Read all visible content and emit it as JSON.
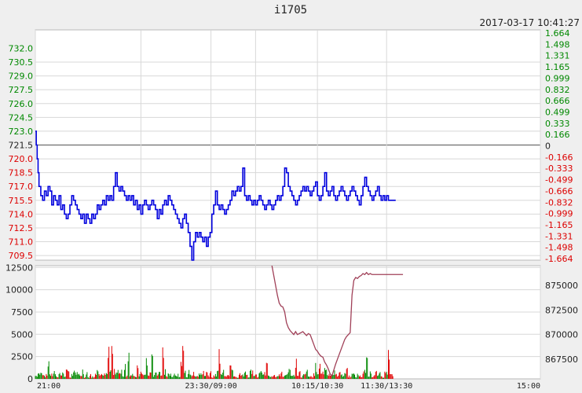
{
  "title": "i1705",
  "timestamp": "2017-03-17 10:41:27",
  "colors": {
    "up": "#e00000",
    "down": "#008800",
    "price_line": "#0000dd",
    "oi_line": "#a04058",
    "grid": "#d8d8d8",
    "axis_left_price_up": "#008800",
    "axis_left_price_down": "#dd0000"
  },
  "chart_data": [
    {
      "type": "line",
      "panel": "price",
      "reference_price": 721.5,
      "ylim": [
        709.0,
        734.0
      ],
      "yticks_left": [
        "732.0",
        "730.5",
        "729.0",
        "727.5",
        "726.0",
        "724.5",
        "723.0",
        "721.5",
        "720.0",
        "718.5",
        "717.0",
        "715.5",
        "714.0",
        "712.5",
        "711.0",
        "709.5"
      ],
      "yticks_right": [
        "1.664",
        "1.498",
        "1.331",
        "1.165",
        "0.999",
        "0.832",
        "0.666",
        "0.499",
        "0.333",
        "0.166",
        "0",
        "-0.166",
        "-0.333",
        "-0.499",
        "-0.666",
        "-0.832",
        "-0.999",
        "-1.165",
        "-1.331",
        "-1.498",
        "-1.664"
      ],
      "x_range": [
        0,
        555
      ],
      "x": [
        0,
        1,
        2,
        3,
        4,
        6,
        8,
        10,
        12,
        14,
        16,
        18,
        20,
        22,
        24,
        26,
        28,
        30,
        32,
        34,
        36,
        38,
        40,
        42,
        44,
        46,
        48,
        50,
        52,
        54,
        56,
        58,
        60,
        62,
        64,
        66,
        68,
        70,
        72,
        74,
        76,
        78,
        80,
        82,
        84,
        86,
        88,
        90,
        92,
        94,
        96,
        98,
        100,
        102,
        104,
        106,
        108,
        110,
        112,
        114,
        116,
        118,
        120,
        122,
        124,
        126,
        128,
        130,
        132,
        134,
        136,
        138,
        140,
        142,
        144,
        146,
        148,
        150,
        152,
        154,
        156,
        158,
        160,
        162,
        164,
        166,
        168,
        170,
        172,
        174,
        176,
        178,
        180,
        182,
        184,
        186,
        188,
        190,
        192,
        194,
        196,
        198,
        200,
        202,
        204,
        206,
        208,
        210,
        212,
        214,
        216,
        218,
        220,
        222,
        224,
        226,
        228,
        230,
        232,
        234,
        236,
        238,
        240,
        242,
        244,
        246,
        248,
        250,
        252,
        254,
        256,
        258,
        260,
        262,
        264,
        266,
        268,
        270,
        272,
        274,
        276,
        278,
        280,
        282,
        284,
        286,
        288,
        290,
        292,
        294,
        296,
        298,
        300,
        302,
        304,
        306,
        308,
        310,
        312,
        314,
        316,
        318,
        320,
        322,
        324,
        326,
        328,
        330,
        332,
        334,
        336,
        338,
        340,
        342,
        344,
        346,
        348,
        350,
        352,
        354,
        356,
        358,
        360,
        362,
        364,
        366,
        368,
        370,
        372,
        374,
        376,
        378,
        380,
        382,
        384,
        386,
        388,
        390,
        392,
        394,
        396,
        398,
        400,
        402,
        404
      ],
      "values": [
        723,
        721.5,
        720,
        718.5,
        717,
        716,
        715.5,
        716.5,
        716,
        717,
        716.5,
        715,
        716,
        715.5,
        715,
        716,
        714.5,
        715,
        714,
        713.5,
        714,
        715,
        716,
        715.5,
        715,
        714.5,
        714,
        713.5,
        714,
        713,
        714,
        713.5,
        713,
        714,
        713.5,
        714,
        715,
        714.5,
        715,
        715.5,
        715,
        716,
        715.5,
        716,
        715.5,
        717,
        718.5,
        717,
        716.5,
        717,
        716.5,
        716,
        715.5,
        716,
        715.5,
        716,
        715,
        715.5,
        714.5,
        715,
        714,
        715,
        715.5,
        715,
        714.5,
        715,
        715.5,
        715,
        714.5,
        713.5,
        714.5,
        714,
        715,
        715.5,
        715,
        716,
        715.5,
        715,
        714.5,
        714,
        713.5,
        713,
        712.5,
        713.5,
        714,
        713,
        712,
        710.5,
        709,
        711,
        712,
        711.5,
        712,
        711.5,
        711,
        711.5,
        710.5,
        711.5,
        712,
        714,
        715,
        716.5,
        715,
        714.5,
        715,
        714.5,
        714,
        714.5,
        715,
        715.5,
        716.5,
        716,
        716.5,
        717,
        716.5,
        717,
        719,
        716,
        715.5,
        716,
        715.5,
        715,
        715.5,
        715,
        715.5,
        716,
        715.5,
        715,
        714.5,
        715,
        715.5,
        715,
        714.5,
        715,
        715.5,
        716,
        715.5,
        716,
        717,
        719,
        718.5,
        717,
        716.5,
        716,
        715.5,
        715,
        715.5,
        716,
        716.5,
        717,
        716.5,
        717,
        716.5,
        716,
        716.5,
        717,
        717.5,
        716,
        715.5,
        716,
        717,
        718.5,
        716.5,
        716,
        716.5,
        717,
        716,
        715.5,
        716,
        716.5,
        717,
        716.5,
        716,
        715.5,
        716,
        716.5,
        717,
        716.5,
        716,
        715.5,
        715,
        716,
        717,
        718,
        717,
        716.5,
        716,
        715.5,
        716,
        716.5,
        717,
        716,
        715.5,
        716,
        715.5,
        716,
        715.5,
        715.5,
        715.5,
        715.5
      ]
    },
    {
      "type": "bar",
      "panel": "volume",
      "ylim": [
        0,
        12700
      ],
      "yticks_left": [
        "12500",
        "10000",
        "7500",
        "5000",
        "2500",
        "0"
      ],
      "yticks_right": [
        "875000",
        "872500",
        "870000",
        "867500"
      ],
      "oi_ylim": [
        865500,
        877000
      ],
      "xticks": [
        "21:00",
        "23:30/09:00",
        "10:15/10:30",
        "11:30/13:30",
        "15:00"
      ],
      "x_range": [
        0,
        555
      ],
      "oi_x": [
        260,
        262,
        264,
        266,
        268,
        270,
        272,
        274,
        276,
        278,
        280,
        282,
        284,
        286,
        288,
        290,
        292,
        294,
        296,
        298,
        300,
        302,
        304,
        306,
        308,
        310,
        312,
        314,
        316,
        318,
        320,
        322,
        324,
        326,
        328,
        330,
        332,
        334,
        336,
        338,
        340,
        342,
        344,
        346,
        348,
        350,
        352,
        354,
        356,
        358,
        360,
        362,
        364,
        366,
        368,
        370,
        372,
        374,
        376,
        378,
        380,
        382,
        384,
        386,
        388,
        390,
        392,
        394,
        396,
        398,
        400,
        402,
        404
      ],
      "oi_values": [
        877000,
        876000,
        875000,
        874000,
        873200,
        872900,
        872800,
        872300,
        871200,
        870700,
        870400,
        870200,
        870000,
        870300,
        870000,
        870100,
        870200,
        870300,
        870100,
        869900,
        870100,
        870000,
        869500,
        869000,
        868500,
        868300,
        868000,
        867800,
        867700,
        867200,
        866900,
        866500,
        866000,
        865800,
        866400,
        867000,
        867500,
        868000,
        868500,
        869000,
        869500,
        869800,
        870000,
        870200,
        874000,
        875500,
        875800,
        875700,
        875900,
        876000,
        876200,
        876100,
        876300,
        876100,
        876200,
        876100
      ]
    }
  ]
}
